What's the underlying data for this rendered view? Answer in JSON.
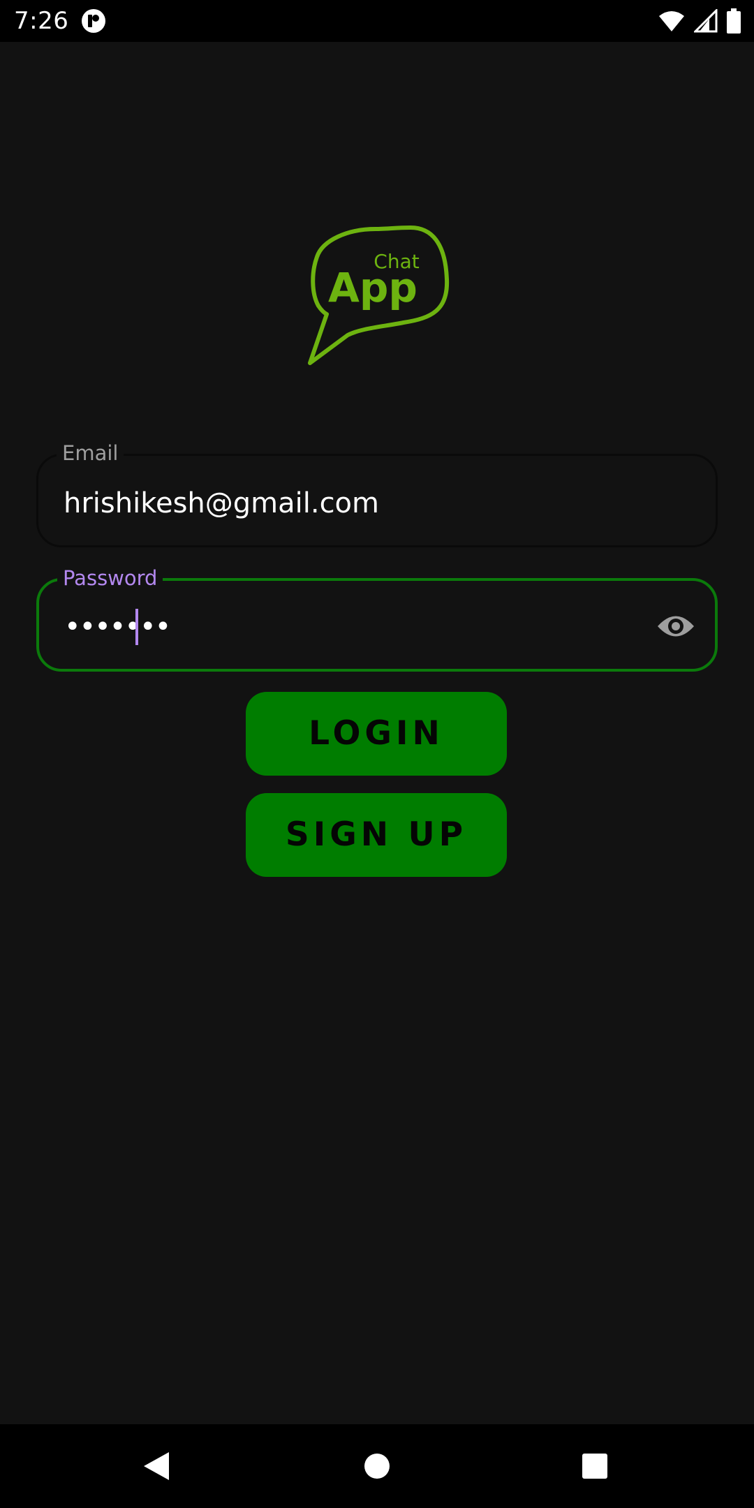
{
  "status_bar": {
    "time": "7:26",
    "icons": [
      "app-notification-icon",
      "wifi-icon",
      "signal-icon",
      "battery-icon"
    ]
  },
  "logo": {
    "small_text": "Chat",
    "big_text": "App",
    "color": "#6db310"
  },
  "form": {
    "email": {
      "label": "Email",
      "value": "hrishikesh@gmail.com"
    },
    "password": {
      "label": "Password",
      "masked_value": "•••••••",
      "toggle_icon": "eye-icon",
      "focused": true
    }
  },
  "buttons": {
    "login_label": "LOGIN",
    "signup_label": "SIGN UP"
  },
  "colors": {
    "background": "#121212",
    "button": "#007d00",
    "focus_border": "#0b7a0b",
    "focus_label": "#b388ef"
  },
  "nav_bar": {
    "icons": [
      "back-icon",
      "home-icon",
      "recents-icon"
    ]
  }
}
